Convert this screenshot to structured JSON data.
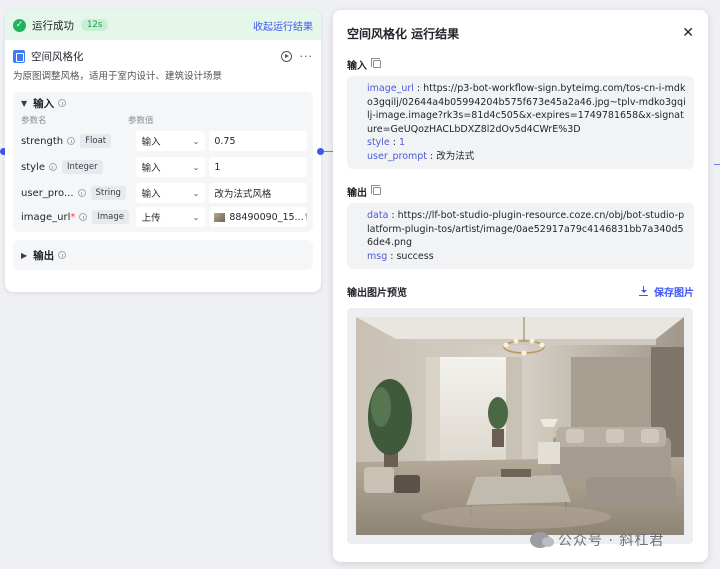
{
  "node": {
    "run_status": "运行成功",
    "run_time": "12s",
    "collapse_label": "收起运行结果",
    "title": "空间风格化",
    "description": "为原图调整风格，适用于室内设计、建筑设计场景",
    "input_section_label": "输入",
    "col_param_name": "参数名",
    "col_param_value": "参数值",
    "params": [
      {
        "name": "strength",
        "type": "Float",
        "source": "输入",
        "value": "0.75"
      },
      {
        "name": "style",
        "type": "Integer",
        "source": "输入",
        "value": "1"
      },
      {
        "name": "user_pro...",
        "type": "String",
        "source": "输入",
        "value": "改为法式风格"
      },
      {
        "name": "image_url",
        "type": "Image",
        "source": "上传",
        "value": "88490090_15..."
      }
    ],
    "output_section_label": "输出"
  },
  "result": {
    "title": "空间风格化 运行结果",
    "input_label": "输入",
    "input": {
      "image_url_key": "image_url",
      "image_url_value": "https://p3-bot-workflow-sign.byteimg.com/tos-cn-i-mdko3gqilj/02644a4b05994204b575f673e45a2a46.jpg~tplv-mdko3gqilj-image.image?rk3s=81d4c505&x-expires=1749781658&x-signature=GeUQozHACLbDXZ8l2dOv5d4CWrE%3D",
      "style_key": "style",
      "style_value": "1",
      "user_prompt_key": "user_prompt",
      "user_prompt_value": "改为法式"
    },
    "output_label": "输出",
    "output": {
      "data_key": "data",
      "data_value": "https://lf-bot-studio-plugin-resource.coze.cn/obj/bot-studio-platform-plugin-tos/artist/image/0ae52917a79c4146831bb7a340d56de4.png",
      "msg_key": "msg",
      "msg_value": "success"
    },
    "preview_label": "输出图片预览",
    "save_label": "保存图片"
  },
  "watermark": "公众号 · 斜杠君",
  "colors": {
    "accent": "#3d55f5",
    "success": "#22b35e",
    "success_bg": "#e5f6ea",
    "key": "#4a5bd8"
  }
}
